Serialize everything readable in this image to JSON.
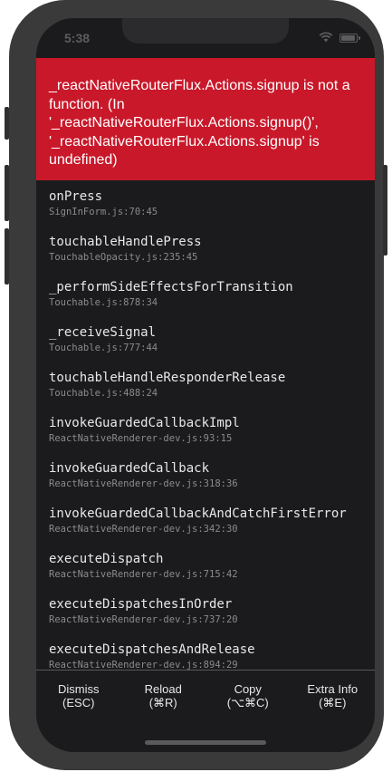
{
  "status_bar": {
    "time": "5:38",
    "wifi_icon": "wifi-icon",
    "battery_icon": "battery-icon"
  },
  "error": {
    "message": "_reactNativeRouterFlux.Actions.signup is not a function. (In '_reactNativeRouterFlux.Actions.signup()', '_reactNativeRouterFlux.Actions.signup' is undefined)",
    "background_color": "#c9182a"
  },
  "stack_frames": [
    {
      "name": "onPress",
      "location": "SignInForm.js:70:45"
    },
    {
      "name": "touchableHandlePress",
      "location": "TouchableOpacity.js:235:45"
    },
    {
      "name": "_performSideEffectsForTransition",
      "location": "Touchable.js:878:34"
    },
    {
      "name": "_receiveSignal",
      "location": "Touchable.js:777:44"
    },
    {
      "name": "touchableHandleResponderRelease",
      "location": "Touchable.js:488:24"
    },
    {
      "name": "invokeGuardedCallbackImpl",
      "location": "ReactNativeRenderer-dev.js:93:15"
    },
    {
      "name": "invokeGuardedCallback",
      "location": "ReactNativeRenderer-dev.js:318:36"
    },
    {
      "name": "invokeGuardedCallbackAndCatchFirstError",
      "location": "ReactNativeRenderer-dev.js:342:30"
    },
    {
      "name": "executeDispatch",
      "location": "ReactNativeRenderer-dev.js:715:42"
    },
    {
      "name": "executeDispatchesInOrder",
      "location": "ReactNativeRenderer-dev.js:737:20"
    },
    {
      "name": "executeDispatchesAndRelease",
      "location": "ReactNativeRenderer-dev.js:894:29"
    }
  ],
  "toolbar": {
    "dismiss_label": "Dismiss",
    "dismiss_shortcut": "(ESC)",
    "reload_label": "Reload",
    "reload_shortcut": "(⌘R)",
    "copy_label": "Copy",
    "copy_shortcut": "(⌥⌘C)",
    "extra_info_label": "Extra Info",
    "extra_info_shortcut": "(⌘E)"
  }
}
